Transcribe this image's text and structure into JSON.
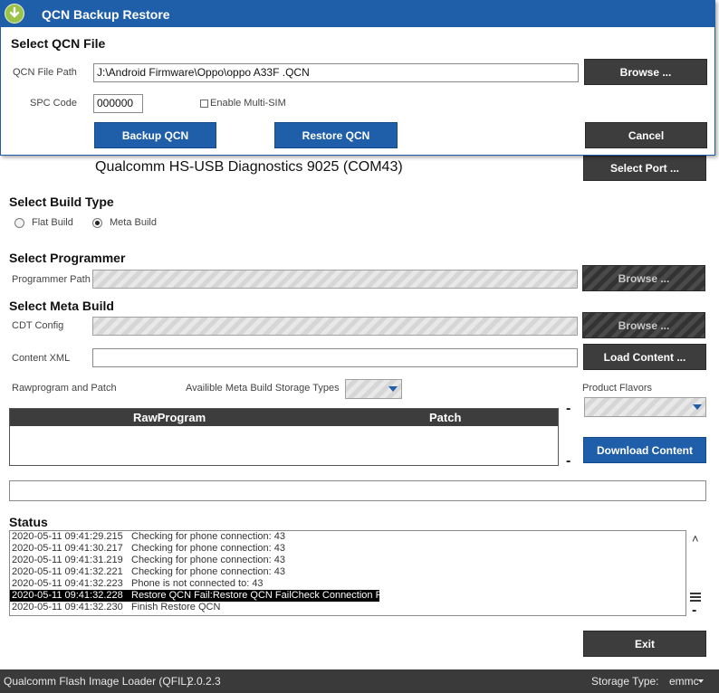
{
  "dialog": {
    "title": "QCN Backup Restore",
    "section_title": "Select QCN File",
    "qcn_path_label": "QCN File Path",
    "qcn_path_value": "J:\\Android Firmware\\Oppo\\oppo A33F .QCN",
    "browse_label": "Browse ...",
    "spc_label": "SPC Code",
    "spc_value": "000000",
    "multisim_label": "Enable Multi-SIM",
    "backup_label": "Backup QCN",
    "restore_label": "Restore QCN",
    "cancel_label": "Cancel"
  },
  "main": {
    "port_text": "Qualcomm HS-USB Diagnostics 9025 (COM43)",
    "select_port_label": "Select Port ...",
    "build_type_title": "Select Build Type",
    "flat_build_label": "Flat Build",
    "meta_build_label": "Meta Build",
    "selected_build": "meta",
    "programmer_title": "Select Programmer",
    "programmer_path_label": "Programmer Path",
    "programmer_browse_label": "Browse ...",
    "meta_title": "Select Meta Build",
    "cdt_label": "CDT Config",
    "cdt_browse_label": "Browse ...",
    "content_xml_label": "Content XML",
    "load_content_label": "Load Content ...",
    "rawprogram_patch_label": "Rawprogram and Patch",
    "storage_types_label": "Availible Meta Build Storage Types",
    "product_flavors_label": "Product Flavors",
    "table_headers": [
      "RawProgram",
      "Patch"
    ],
    "download_content_label": "Download Content",
    "minus_symbol": "-",
    "status_title": "Status",
    "exit_label": "Exit"
  },
  "status_log": [
    {
      "time": "2020-05-11 09:41:29.215",
      "msg": "Checking for phone connection: 43",
      "selected": false
    },
    {
      "time": "2020-05-11 09:41:30.217",
      "msg": "Checking for phone connection: 43",
      "selected": false
    },
    {
      "time": "2020-05-11 09:41:31.219",
      "msg": "Checking for phone connection: 43",
      "selected": false
    },
    {
      "time": "2020-05-11 09:41:32.221",
      "msg": "Checking for phone connection: 43",
      "selected": false
    },
    {
      "time": "2020-05-11 09:41:32.223",
      "msg": "Phone is not connected to: 43",
      "selected": false
    },
    {
      "time": "2020-05-11 09:41:32.228",
      "msg": "Restore QCN Fail:Restore QCN FailCheck Connection Fail",
      "selected": true
    },
    {
      "time": "2020-05-11 09:41:32.230",
      "msg": "Finish Restore QCN",
      "selected": false
    }
  ],
  "footer": {
    "app_name": "Qualcomm Flash Image Loader (QFIL)",
    "version": "2.0.2.3",
    "storage_type_label": "Storage Type:",
    "storage_type_value": "emmc"
  },
  "colors": {
    "accent_blue": "#1f5ea8",
    "dark_button": "#3d3d3d",
    "footer_bg": "#3a3a3a"
  }
}
